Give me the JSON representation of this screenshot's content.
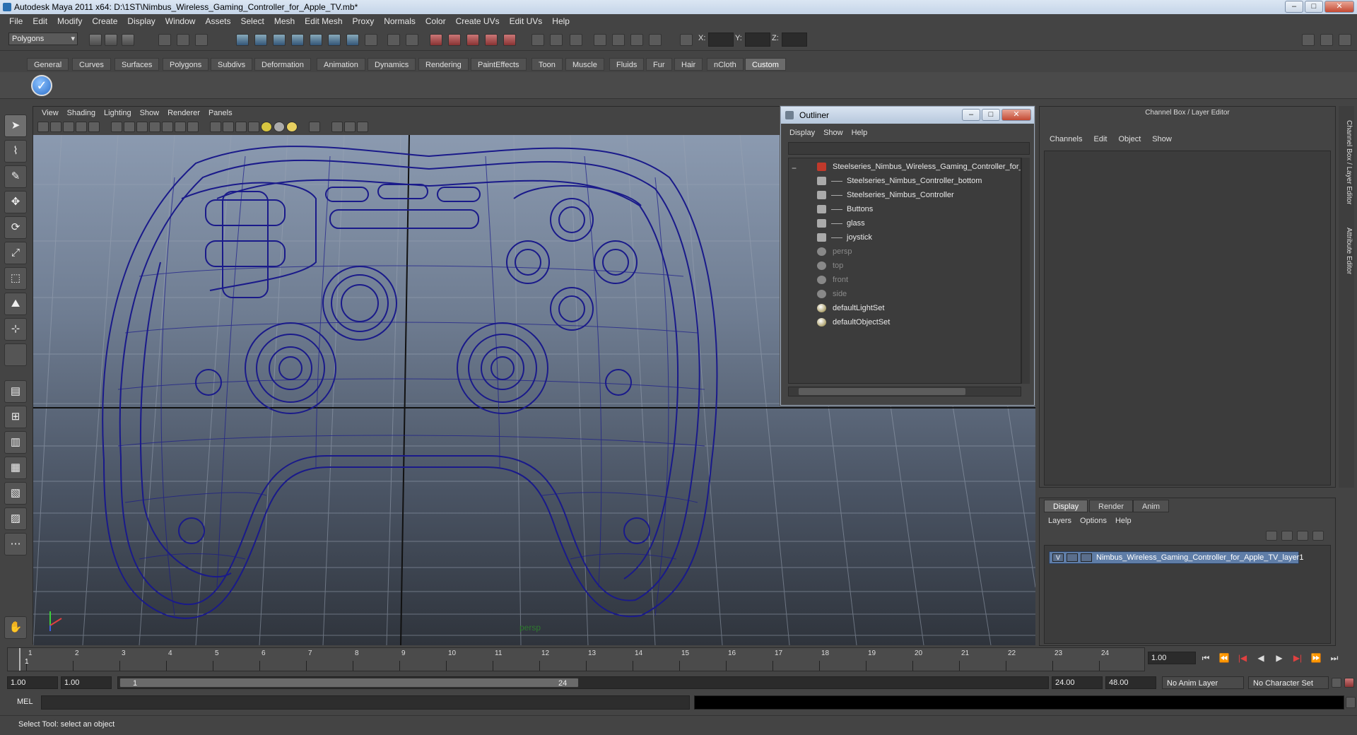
{
  "window": {
    "title": "Autodesk Maya 2011 x64: D:\\1ST\\Nimbus_Wireless_Gaming_Controller_for_Apple_TV.mb*",
    "minimize": "–",
    "maximize": "□",
    "close": "✕"
  },
  "menubar": [
    "File",
    "Edit",
    "Modify",
    "Create",
    "Display",
    "Window",
    "Assets",
    "Select",
    "Mesh",
    "Edit Mesh",
    "Proxy",
    "Normals",
    "Color",
    "Create UVs",
    "Edit UVs",
    "Help"
  ],
  "statusline": {
    "mode": "Polygons",
    "x_label": "X:",
    "y_label": "Y:",
    "z_label": "Z:"
  },
  "shelf_tabs": [
    "General",
    "Curves",
    "Surfaces",
    "Polygons",
    "Subdivs",
    "Deformation",
    "Animation",
    "Dynamics",
    "Rendering",
    "PaintEffects",
    "Toon",
    "Muscle",
    "Fluids",
    "Fur",
    "Hair",
    "nCloth",
    "Custom"
  ],
  "shelf_active": "Custom",
  "viewport": {
    "menu": [
      "View",
      "Shading",
      "Lighting",
      "Show",
      "Renderer",
      "Panels"
    ],
    "camera_label": "persp",
    "wire_color": "#1a1a8a"
  },
  "outliner": {
    "title": "Outliner",
    "menu": [
      "Display",
      "Show",
      "Help"
    ],
    "collapse": "−",
    "items": [
      {
        "label": "Steelseries_Nimbus_Wireless_Gaming_Controller_for_",
        "icon": "mesh-group-icon",
        "indent": 0,
        "dim": false
      },
      {
        "label": "Steelseries_Nimbus_Controller_bottom",
        "icon": "mesh-icon",
        "indent": 1,
        "dim": false
      },
      {
        "label": "Steelseries_Nimbus_Controller",
        "icon": "mesh-icon",
        "indent": 1,
        "dim": false
      },
      {
        "label": "Buttons",
        "icon": "mesh-icon",
        "indent": 1,
        "dim": false
      },
      {
        "label": "glass",
        "icon": "mesh-icon",
        "indent": 1,
        "dim": false
      },
      {
        "label": "joystick",
        "icon": "mesh-icon",
        "indent": 1,
        "dim": false
      },
      {
        "label": "persp",
        "icon": "camera-icon",
        "indent": 0,
        "dim": true
      },
      {
        "label": "top",
        "icon": "camera-icon",
        "indent": 0,
        "dim": true
      },
      {
        "label": "front",
        "icon": "camera-icon",
        "indent": 0,
        "dim": true
      },
      {
        "label": "side",
        "icon": "camera-icon",
        "indent": 0,
        "dim": true
      },
      {
        "label": "defaultLightSet",
        "icon": "set-icon",
        "indent": 0,
        "dim": false
      },
      {
        "label": "defaultObjectSet",
        "icon": "set-icon",
        "indent": 0,
        "dim": false
      }
    ]
  },
  "channel_box": {
    "title": "Channel Box / Layer Editor",
    "menu": [
      "Channels",
      "Edit",
      "Object",
      "Show"
    ]
  },
  "side_tabs": [
    "Channel Box / Layer Editor",
    "Attribute Editor"
  ],
  "layer_editor": {
    "tabs": [
      "Display",
      "Render",
      "Anim"
    ],
    "active_tab": "Display",
    "menu": [
      "Layers",
      "Options",
      "Help"
    ],
    "layer_visible": "V",
    "layer_name": "Nimbus_Wireless_Gaming_Controller_for_Apple_TV_layer1"
  },
  "timeline": {
    "ticks": [
      "1",
      "2",
      "3",
      "4",
      "5",
      "6",
      "7",
      "8",
      "9",
      "10",
      "11",
      "12",
      "13",
      "14",
      "15",
      "16",
      "17",
      "18",
      "19",
      "20",
      "21",
      "22",
      "23",
      "24"
    ],
    "current_frame": "1",
    "current_time_field": "1.00"
  },
  "playback_controls": [
    "⏮",
    "⏪",
    "|◀",
    "◀",
    "▶",
    "▶|",
    "⏩",
    "⏭"
  ],
  "range": {
    "start": "1.00",
    "playback_start": "1.00",
    "slider_start": "1",
    "slider_end": "24",
    "playback_end": "24.00",
    "end": "48.00",
    "anim_layer": "No Anim Layer",
    "character_set": "No Character Set"
  },
  "command_line": {
    "label": "MEL"
  },
  "help_line": {
    "text": "Select Tool: select an object"
  }
}
